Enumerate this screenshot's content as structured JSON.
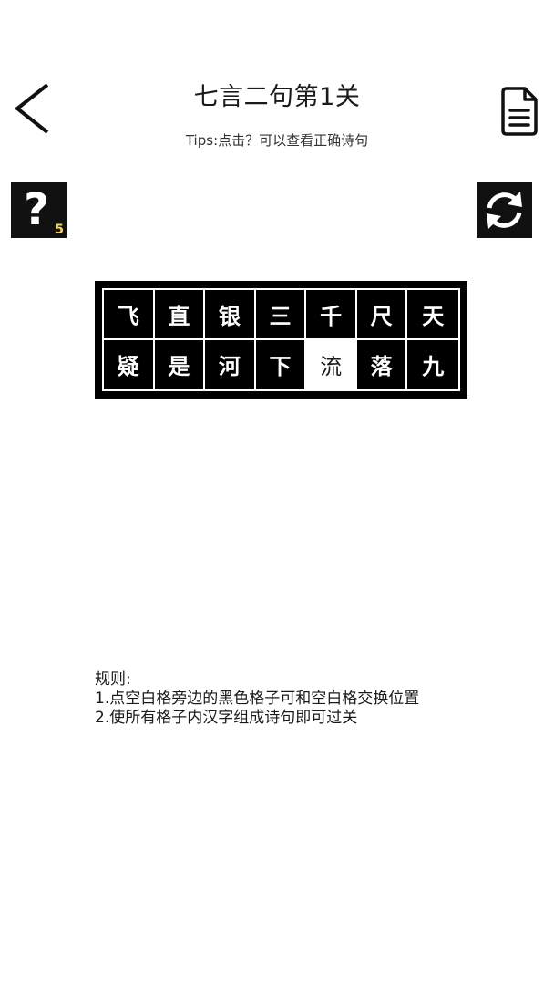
{
  "header": {
    "title": "七言二句第1关",
    "tips": "Tips:点击？可以查看正确诗句"
  },
  "toolbar": {
    "hint_symbol": "?",
    "hint_count": "5"
  },
  "board": {
    "cells": [
      "飞",
      "直",
      "银",
      "三",
      "千",
      "尺",
      "天",
      "疑",
      "是",
      "河",
      "下",
      "流",
      "落",
      "九"
    ],
    "blank_index": 11
  },
  "rules": {
    "heading": "规则:",
    "line1": "1.点空白格旁边的黑色格子可和空白格交换位置",
    "line2": "2.使所有格子内汉字组成诗句即可过关"
  },
  "icons": {
    "back": "back-chevron-icon",
    "document": "document-icon",
    "refresh": "refresh-icon"
  },
  "colors": {
    "tile": "#000000",
    "blank": "#ffffff",
    "hint_badge": "#f0d35a"
  }
}
